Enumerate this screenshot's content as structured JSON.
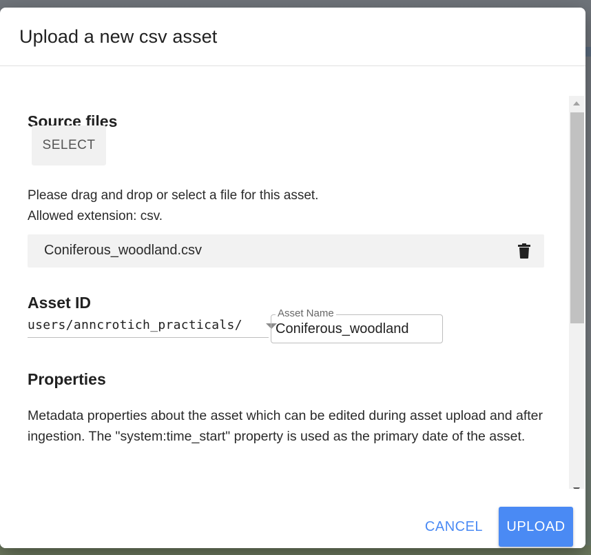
{
  "dialog": {
    "title": "Upload a new csv asset"
  },
  "source_files": {
    "heading": "Source files",
    "select_label": "SELECT",
    "help_line1": "Please drag and drop or select a file for this asset.",
    "help_line2": "Allowed extension: csv.",
    "file_name": "Coniferous_woodland.csv",
    "delete_icon": "trash-icon"
  },
  "asset_id": {
    "heading": "Asset ID",
    "path": "users/anncrotich_practicals/",
    "name_label": "Asset Name",
    "name_value": "Coniferous_woodland"
  },
  "properties": {
    "heading": "Properties",
    "description": "Metadata properties about the asset which can be edited during asset upload and after ingestion. The \"system:time_start\" property is used as the primary date of the asset."
  },
  "footer": {
    "cancel_label": "CANCEL",
    "upload_label": "UPLOAD"
  },
  "colors": {
    "accent": "#4a8af4",
    "file_row_bg": "#f2f2f2",
    "select_bg": "#f1f1f1"
  }
}
